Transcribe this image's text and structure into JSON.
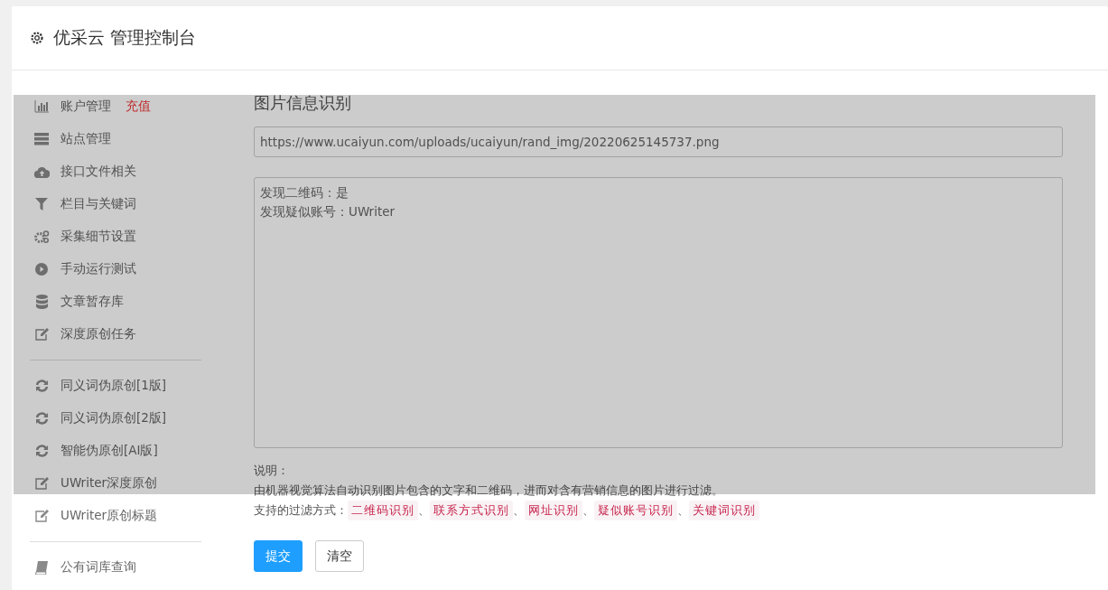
{
  "header": {
    "title": "优采云 管理控制台"
  },
  "sidebar": {
    "groups": [
      [
        {
          "label": "账户管理",
          "badge": "充值"
        },
        {
          "label": "站点管理"
        },
        {
          "label": "接口文件相关"
        },
        {
          "label": "栏目与关键词"
        },
        {
          "label": "采集细节设置"
        },
        {
          "label": "手动运行测试"
        },
        {
          "label": "文章暂存库"
        },
        {
          "label": "深度原创任务"
        }
      ],
      [
        {
          "label": "同义词伪原创[1版]"
        },
        {
          "label": "同义词伪原创[2版]"
        },
        {
          "label": "智能伪原创[AI版]"
        },
        {
          "label": "UWriter深度原创"
        },
        {
          "label": "UWriter原创标题"
        }
      ],
      [
        {
          "label": "公有词库查询"
        }
      ]
    ]
  },
  "main": {
    "title": "图片信息识别",
    "url_field": {
      "value": "https://www.ucaiyun.com/uploads/ucaiyun/rand_img/20220625145737.png"
    },
    "result_field": {
      "lines": [
        "发现二维码：是",
        "发现疑似账号：UWriter"
      ]
    },
    "note_label": "说明：",
    "note_text": "由机器视觉算法自动识别图片包含的文字和二维码，进而对含有营销信息的图片进行过滤。",
    "filters_label": "支持的过滤方式：",
    "filters": [
      "二维码识别",
      "联系方式识别",
      "网址识别",
      "疑似账号识别",
      "关键词识别"
    ],
    "separator": "、",
    "buttons": [
      {
        "label": "提交",
        "kind": "primary"
      },
      {
        "label": "清空",
        "kind": "default"
      }
    ]
  },
  "overlay": {
    "shown": true
  }
}
